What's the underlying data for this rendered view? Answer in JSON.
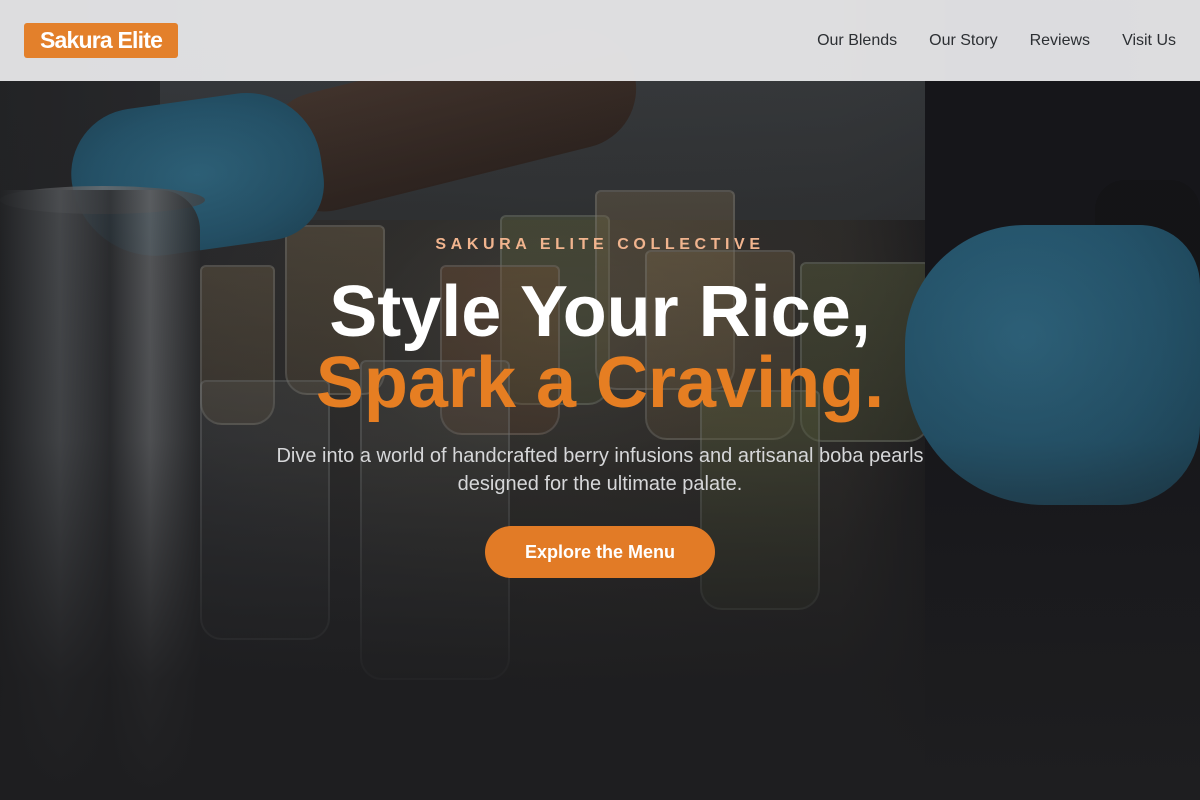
{
  "brand": {
    "logo_text": "Sakura Elite"
  },
  "nav": {
    "items": [
      {
        "label": "Our Blends"
      },
      {
        "label": "Our Story"
      },
      {
        "label": "Reviews"
      },
      {
        "label": "Visit Us"
      }
    ]
  },
  "hero": {
    "eyebrow": "SAKURA ELITE COLLECTIVE",
    "headline_line1": "Style Your Rice,",
    "headline_line2": "Spark a Craving.",
    "subtitle": "Dive into a world of handcrafted berry infusions and artisanal boba pearls designed for the ultimate palate.",
    "cta_label": "Explore the Menu"
  },
  "colors": {
    "accent": "#e67e22",
    "eyebrow": "#f1b48e",
    "header_bg": "#ececee",
    "nav_text": "#2c2f33"
  }
}
